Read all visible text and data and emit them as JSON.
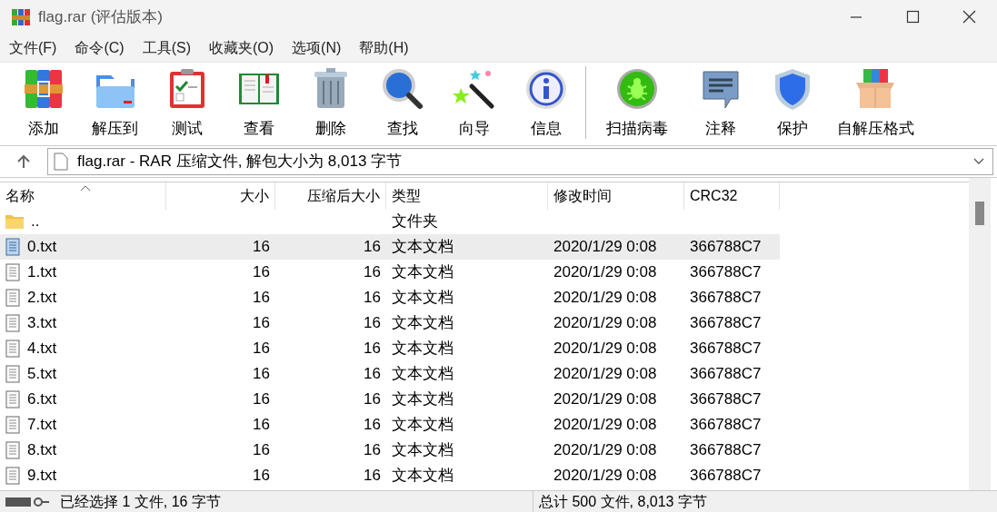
{
  "window": {
    "title": "flag.rar (评估版本)"
  },
  "menu": [
    "文件(F)",
    "命令(C)",
    "工具(S)",
    "收藏夹(O)",
    "选项(N)",
    "帮助(H)"
  ],
  "toolbar": {
    "groups": [
      [
        "添加",
        "解压到",
        "测试",
        "查看",
        "删除",
        "查找",
        "向导",
        "信息"
      ],
      [
        "扫描病毒",
        "注释",
        "保护",
        "自解压格式"
      ]
    ]
  },
  "address": {
    "value": "flag.rar - RAR 压缩文件, 解包大小为 8,013 字节"
  },
  "table": {
    "columns": [
      "名称",
      "大小",
      "压缩后大小",
      "类型",
      "修改时间",
      "CRC32"
    ],
    "rows": [
      {
        "kind": "folder",
        "selected": false,
        "cells": [
          "..",
          "",
          "",
          "文件夹",
          "",
          ""
        ]
      },
      {
        "kind": "file",
        "selected": true,
        "cells": [
          "0.txt",
          "16",
          "16",
          "文本文档",
          "2020/1/29 0:08",
          "366788C7"
        ]
      },
      {
        "kind": "file",
        "selected": false,
        "cells": [
          "1.txt",
          "16",
          "16",
          "文本文档",
          "2020/1/29 0:08",
          "366788C7"
        ]
      },
      {
        "kind": "file",
        "selected": false,
        "cells": [
          "2.txt",
          "16",
          "16",
          "文本文档",
          "2020/1/29 0:08",
          "366788C7"
        ]
      },
      {
        "kind": "file",
        "selected": false,
        "cells": [
          "3.txt",
          "16",
          "16",
          "文本文档",
          "2020/1/29 0:08",
          "366788C7"
        ]
      },
      {
        "kind": "file",
        "selected": false,
        "cells": [
          "4.txt",
          "16",
          "16",
          "文本文档",
          "2020/1/29 0:08",
          "366788C7"
        ]
      },
      {
        "kind": "file",
        "selected": false,
        "cells": [
          "5.txt",
          "16",
          "16",
          "文本文档",
          "2020/1/29 0:08",
          "366788C7"
        ]
      },
      {
        "kind": "file",
        "selected": false,
        "cells": [
          "6.txt",
          "16",
          "16",
          "文本文档",
          "2020/1/29 0:08",
          "366788C7"
        ]
      },
      {
        "kind": "file",
        "selected": false,
        "cells": [
          "7.txt",
          "16",
          "16",
          "文本文档",
          "2020/1/29 0:08",
          "366788C7"
        ]
      },
      {
        "kind": "file",
        "selected": false,
        "cells": [
          "8.txt",
          "16",
          "16",
          "文本文档",
          "2020/1/29 0:08",
          "366788C7"
        ]
      },
      {
        "kind": "file",
        "selected": false,
        "cells": [
          "9.txt",
          "16",
          "16",
          "文本文档",
          "2020/1/29 0:08",
          "366788C7"
        ]
      }
    ]
  },
  "status_bar": {
    "left": "已经选择 1 文件, 16 字节",
    "right": "总计 500 文件, 8,013 字节"
  }
}
